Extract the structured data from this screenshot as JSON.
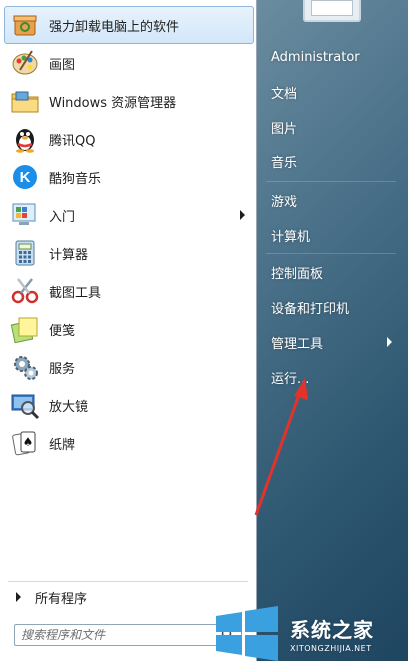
{
  "programs": [
    {
      "label": "强力卸载电脑上的软件",
      "icon": "uninstall-box-icon",
      "highlighted": true,
      "has_submenu": false
    },
    {
      "label": "画图",
      "icon": "paint-palette-icon",
      "highlighted": false,
      "has_submenu": false
    },
    {
      "label": "Windows 资源管理器",
      "icon": "folder-explorer-icon",
      "highlighted": false,
      "has_submenu": false
    },
    {
      "label": "腾讯QQ",
      "icon": "qq-penguin-icon",
      "highlighted": false,
      "has_submenu": false
    },
    {
      "label": "酷狗音乐",
      "icon": "kugou-k-icon",
      "highlighted": false,
      "has_submenu": false
    },
    {
      "label": "入门",
      "icon": "getting-started-icon",
      "highlighted": false,
      "has_submenu": true
    },
    {
      "label": "计算器",
      "icon": "calculator-icon",
      "highlighted": false,
      "has_submenu": false
    },
    {
      "label": "截图工具",
      "icon": "snipping-scissors-icon",
      "highlighted": false,
      "has_submenu": false
    },
    {
      "label": "便笺",
      "icon": "sticky-notes-icon",
      "highlighted": false,
      "has_submenu": false
    },
    {
      "label": "服务",
      "icon": "services-gear-icon",
      "highlighted": false,
      "has_submenu": false
    },
    {
      "label": "放大镜",
      "icon": "magnifier-icon",
      "highlighted": false,
      "has_submenu": false
    },
    {
      "label": "纸牌",
      "icon": "solitaire-cards-icon",
      "highlighted": false,
      "has_submenu": false
    }
  ],
  "all_programs_label": "所有程序",
  "search": {
    "placeholder": "搜索程序和文件"
  },
  "right": {
    "user": "Administrator",
    "documents": "文档",
    "pictures": "图片",
    "music": "音乐",
    "games": "游戏",
    "computer": "计算机",
    "control_panel": "控制面板",
    "devices_printers": "设备和打印机",
    "admin_tools": "管理工具",
    "run": "运行..."
  },
  "watermark": {
    "text": "系统之家",
    "url": "XITONGZHIJIA.NET"
  },
  "colors": {
    "highlight": "#d3e7f9",
    "right_panel": "#3f6880",
    "annotation_arrow": "#e2332b"
  }
}
